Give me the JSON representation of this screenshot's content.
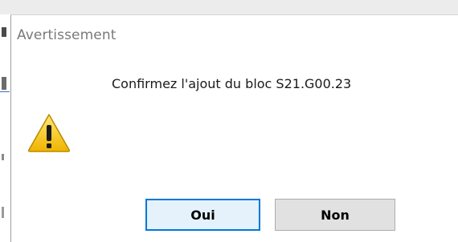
{
  "dialog": {
    "title": "Avertissement",
    "message": "Confirmez l'ajout du bloc S21.G00.23",
    "icon": "warning-icon",
    "buttons": {
      "yes_label": "Oui",
      "no_label": "Non"
    }
  },
  "colors": {
    "warning_fill": "#f5c400",
    "focus_border": "#0078d7",
    "button_face": "#e1e1e1"
  }
}
